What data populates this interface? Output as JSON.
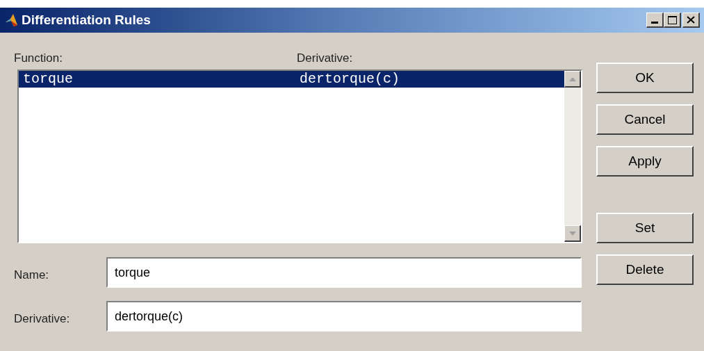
{
  "window": {
    "title": "Differentiation Rules"
  },
  "list": {
    "columns": [
      "Function:",
      "Derivative:"
    ],
    "rows": [
      {
        "function": "torque",
        "derivative": "dertorque(c)",
        "selected": true
      }
    ]
  },
  "fields": [
    {
      "label": "Name:",
      "value": "torque"
    },
    {
      "label": "Derivative:",
      "value": "dertorque(c)"
    }
  ],
  "button_groups": [
    [
      "OK",
      "Cancel",
      "Apply"
    ],
    [
      "Set",
      "Delete"
    ]
  ]
}
